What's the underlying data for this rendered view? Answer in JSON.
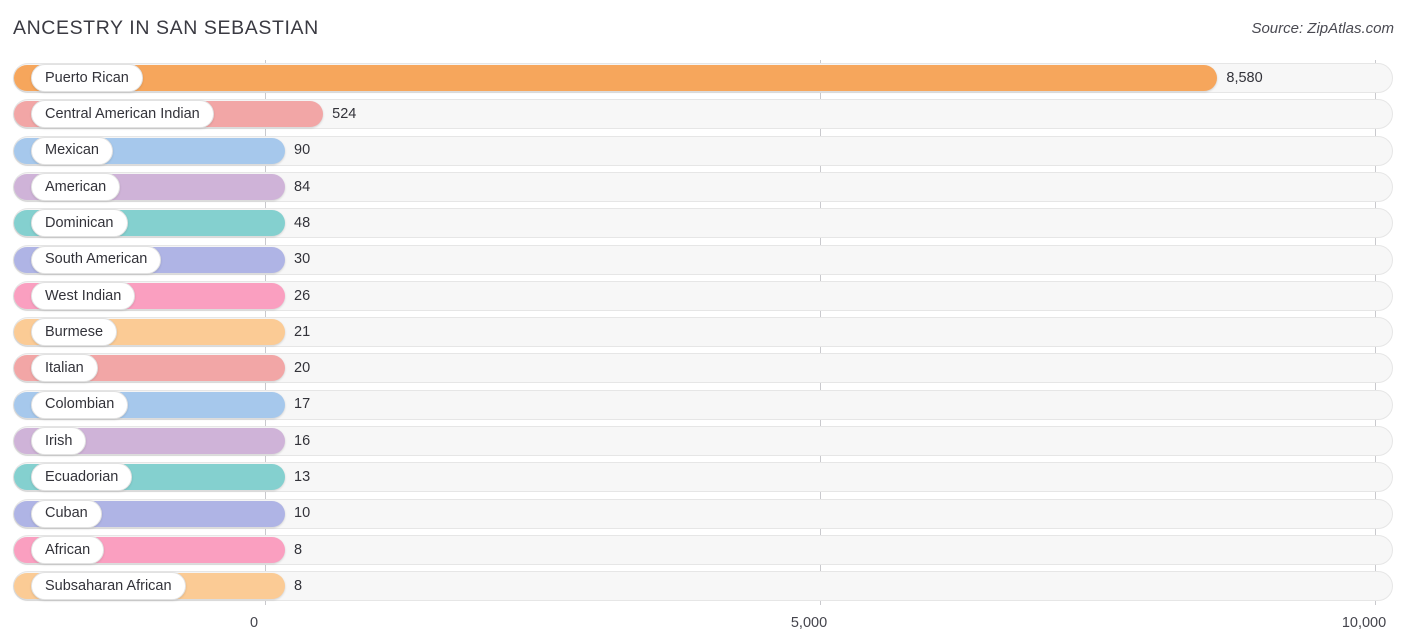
{
  "header": {
    "title": "ANCESTRY IN SAN SEBASTIAN",
    "source": "Source: ZipAtlas.com"
  },
  "axis": {
    "ticks": [
      "0",
      "5,000",
      "10,000"
    ]
  },
  "chart_data": {
    "type": "bar",
    "orientation": "horizontal",
    "title": "ANCESTRY IN SAN SEBASTIAN",
    "xlabel": "",
    "ylabel": "",
    "xlim": [
      0,
      10000
    ],
    "grid": true,
    "legend": "none",
    "tick_values": [
      0,
      5000,
      10000
    ],
    "tick_labels": [
      "0",
      "5,000",
      "10,000"
    ],
    "categories": [
      "Puerto Rican",
      "Central American Indian",
      "Mexican",
      "American",
      "Dominican",
      "South American",
      "West Indian",
      "Burmese",
      "Italian",
      "Colombian",
      "Irish",
      "Ecuadorian",
      "Cuban",
      "African",
      "Subsaharan African"
    ],
    "values": [
      8580,
      524,
      90,
      84,
      48,
      30,
      26,
      21,
      20,
      17,
      16,
      13,
      10,
      8,
      8
    ],
    "value_labels": [
      "8,580",
      "524",
      "90",
      "84",
      "48",
      "30",
      "26",
      "21",
      "20",
      "17",
      "16",
      "13",
      "10",
      "8",
      "8"
    ],
    "colors": [
      "#f6a65c",
      "#f2a6a6",
      "#a6c8ec",
      "#cfb3d8",
      "#84d0cf",
      "#afb4e5",
      "#fa9fc0",
      "#fbcb95",
      "#f2a6a6",
      "#a6c8ec",
      "#cfb3d8",
      "#84d0cf",
      "#afb4e5",
      "#fa9fc0",
      "#fbcb95"
    ]
  }
}
